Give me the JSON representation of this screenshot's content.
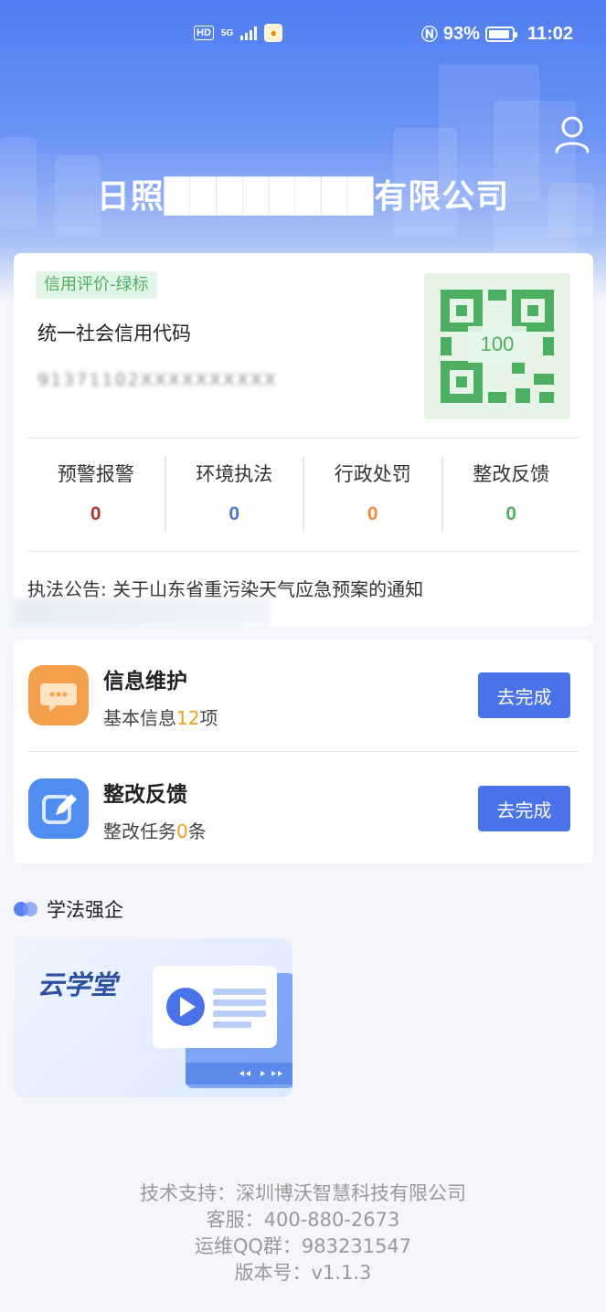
{
  "status_bar": {
    "hd": "HD",
    "network": "5G",
    "battery_percent": "93%",
    "battery_level": 0.93,
    "time": "11:02"
  },
  "header": {
    "company_name": "日照████████有限公司"
  },
  "credit": {
    "badge": "信用评价-绿标",
    "code_label": "统一社会信用代码",
    "code_value": "91371102XXXXXXXXXX",
    "qr_score": "100"
  },
  "stats": [
    {
      "label": "预警报警",
      "value": "0",
      "color": "#a83a2e"
    },
    {
      "label": "环境执法",
      "value": "0",
      "color": "#4a78d8"
    },
    {
      "label": "行政处罚",
      "value": "0",
      "color": "#f08a3c"
    },
    {
      "label": "整改反馈",
      "value": "0",
      "color": "#4caf62"
    }
  ],
  "notice": "执法公告: 关于山东省重污染天气应急预案的通知",
  "tasks": [
    {
      "title": "信息维护",
      "sub_prefix": "基本信息",
      "sub_num": "12",
      "sub_suffix": "项",
      "button": "去完成",
      "icon": "chat-bubble-icon",
      "icon_color": "#f4a04a"
    },
    {
      "title": "整改反馈",
      "sub_prefix": "整改任务",
      "sub_num": "0",
      "sub_suffix": "条",
      "button": "去完成",
      "icon": "edit-pencil-icon",
      "icon_color": "#4f8ef0"
    }
  ],
  "section": {
    "title": "学法强企"
  },
  "class_card": {
    "title": "云学堂"
  },
  "footer": {
    "support": "技术支持：深圳博沃智慧科技有限公司",
    "service": "客服：400-880-2673",
    "qq": "运维QQ群：983231547",
    "version": "版本号：v1.1.3"
  },
  "colors": {
    "primary": "#4a73ea",
    "green": "#4caf62"
  }
}
